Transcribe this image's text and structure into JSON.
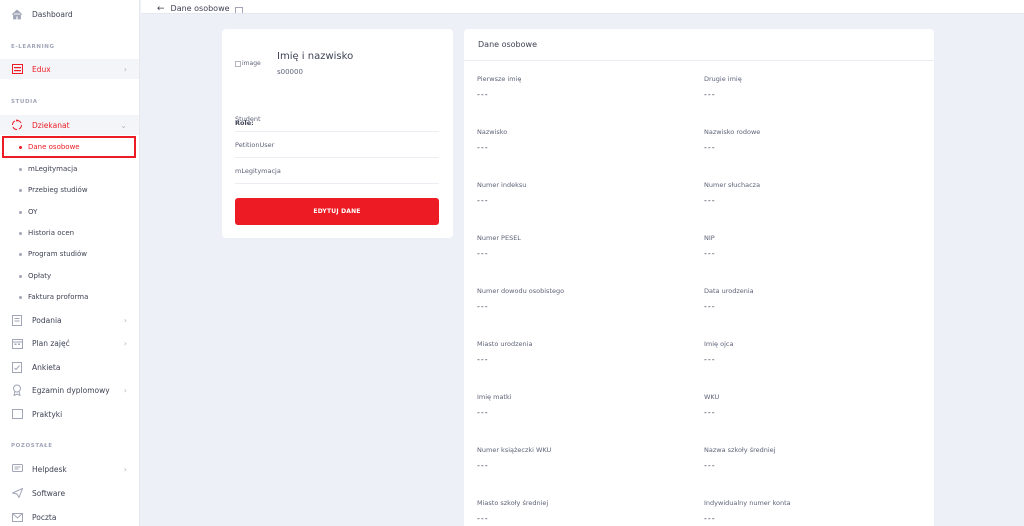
{
  "sidebar": {
    "dashboard": "Dashboard",
    "sections": {
      "elearning": "E-LEARNING",
      "studia": "STUDIA",
      "pozostale": "POZOSTAŁE"
    },
    "edux": "Edux",
    "dziekanat": "Dziekanat",
    "dziekanat_items": [
      "Dane osobowe",
      "mLegitymacja",
      "Przebieg studiów",
      "OY",
      "Historia ocen",
      "Program studiów",
      "Opłaty",
      "Faktura proforma"
    ],
    "items": [
      "Podania",
      "Plan zajęć",
      "Ankieta",
      "Egzamin dyplomowy",
      "Praktyki"
    ],
    "other_items": [
      "Helpdesk",
      "Software",
      "Poczta"
    ]
  },
  "topbar": {
    "back_icon": "arrow-left",
    "title": "Dane osobowe"
  },
  "profile": {
    "image_alt": "image",
    "name": "Imię i nazwisko",
    "id": "s00000",
    "roles_label": "Role:",
    "roles": [
      "Student",
      "PetitionUser",
      "mLegitymacja"
    ],
    "edit_button": "EDYTUJ DANE"
  },
  "details": {
    "title": "Dane osobowe",
    "fields": [
      {
        "label": "Pierwsze imię",
        "value": "---"
      },
      {
        "label": "Drugie imię",
        "value": "---"
      },
      {
        "label": "Nazwisko",
        "value": "---"
      },
      {
        "label": "Nazwisko rodowe",
        "value": "---"
      },
      {
        "label": "Numer indeksu",
        "value": "---"
      },
      {
        "label": "Numer słuchacza",
        "value": "---"
      },
      {
        "label": "Numer PESEL",
        "value": "---"
      },
      {
        "label": "NIP",
        "value": "---"
      },
      {
        "label": "Numer dowodu osobistego",
        "value": "---"
      },
      {
        "label": "Data urodzenia",
        "value": "---"
      },
      {
        "label": "Miasto urodzenia",
        "value": "---"
      },
      {
        "label": "Imię ojca",
        "value": "---"
      },
      {
        "label": "Imię matki",
        "value": "---"
      },
      {
        "label": "WKU",
        "value": "---"
      },
      {
        "label": "Numer książeczki WKU",
        "value": "---"
      },
      {
        "label": "Nazwa szkoły średniej",
        "value": "---"
      },
      {
        "label": "Miasto szkoły średniej",
        "value": "---"
      },
      {
        "label": "Indywidualny numer konta",
        "value": "---"
      }
    ]
  },
  "colors": {
    "accent": "#ed1c24",
    "background": "#eef0f8"
  }
}
